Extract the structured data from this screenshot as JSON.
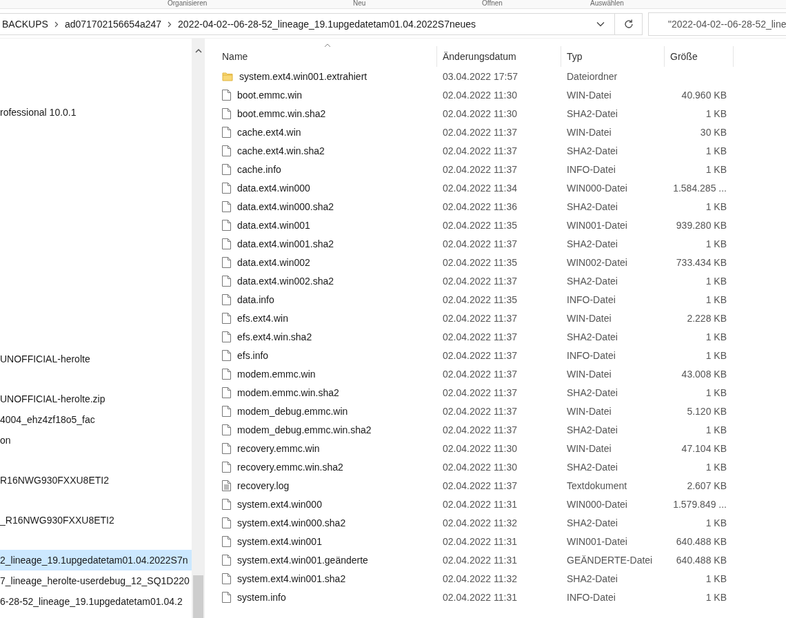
{
  "ribbon_groups": [
    "Organisieren",
    "Neu",
    "Öffnen",
    "Auswählen"
  ],
  "breadcrumb": [
    "BACKUPS",
    "ad071702156654a247",
    "2022-04-02--06-28-52_lineage_19.1upgedatetam01.04.2022S7neues"
  ],
  "search": {
    "value": "\"2022-04-02--06-28-52_line"
  },
  "nav_items": [
    {
      "label": "rofessional 10.0.1",
      "selected": false
    },
    {
      "label": "UNOFFICIAL-herolte",
      "selected": false
    },
    {
      "label": "UNOFFICIAL-herolte.zip",
      "selected": false
    },
    {
      "label": "4004_ehz4zf18o5_fac",
      "selected": false
    },
    {
      "label": "on",
      "selected": false
    },
    {
      "label": "R16NWG930FXXU8ETI2",
      "selected": false
    },
    {
      "label": "_R16NWG930FXXU8ETI2",
      "selected": false
    },
    {
      "label": "2_lineage_19.1upgedatetam01.04.2022S7n",
      "selected": true
    },
    {
      "label": "7_lineage_herolte-userdebug_12_SQ1D220",
      "selected": false
    },
    {
      "label": "6-28-52_lineage_19.1upgedatetam01.04.2",
      "selected": false
    }
  ],
  "table": {
    "columns": [
      "Name",
      "Änderungsdatum",
      "Typ",
      "Größe"
    ],
    "rows": [
      {
        "kind": "folder",
        "name": "system.ext4.win001.extrahiert",
        "date": "03.04.2022 17:57",
        "type": "Dateiordner",
        "size": ""
      },
      {
        "kind": "file",
        "name": "boot.emmc.win",
        "date": "02.04.2022 11:30",
        "type": "WIN-Datei",
        "size": "40.960 KB"
      },
      {
        "kind": "file",
        "name": "boot.emmc.win.sha2",
        "date": "02.04.2022 11:30",
        "type": "SHA2-Datei",
        "size": "1 KB"
      },
      {
        "kind": "file",
        "name": "cache.ext4.win",
        "date": "02.04.2022 11:37",
        "type": "WIN-Datei",
        "size": "30 KB"
      },
      {
        "kind": "file",
        "name": "cache.ext4.win.sha2",
        "date": "02.04.2022 11:37",
        "type": "SHA2-Datei",
        "size": "1 KB"
      },
      {
        "kind": "file",
        "name": "cache.info",
        "date": "02.04.2022 11:37",
        "type": "INFO-Datei",
        "size": "1 KB"
      },
      {
        "kind": "file",
        "name": "data.ext4.win000",
        "date": "02.04.2022 11:34",
        "type": "WIN000-Datei",
        "size": "1.584.285 ..."
      },
      {
        "kind": "file",
        "name": "data.ext4.win000.sha2",
        "date": "02.04.2022 11:36",
        "type": "SHA2-Datei",
        "size": "1 KB"
      },
      {
        "kind": "file",
        "name": "data.ext4.win001",
        "date": "02.04.2022 11:35",
        "type": "WIN001-Datei",
        "size": "939.280 KB"
      },
      {
        "kind": "file",
        "name": "data.ext4.win001.sha2",
        "date": "02.04.2022 11:37",
        "type": "SHA2-Datei",
        "size": "1 KB"
      },
      {
        "kind": "file",
        "name": "data.ext4.win002",
        "date": "02.04.2022 11:35",
        "type": "WIN002-Datei",
        "size": "733.434 KB"
      },
      {
        "kind": "file",
        "name": "data.ext4.win002.sha2",
        "date": "02.04.2022 11:37",
        "type": "SHA2-Datei",
        "size": "1 KB"
      },
      {
        "kind": "file",
        "name": "data.info",
        "date": "02.04.2022 11:35",
        "type": "INFO-Datei",
        "size": "1 KB"
      },
      {
        "kind": "file",
        "name": "efs.ext4.win",
        "date": "02.04.2022 11:37",
        "type": "WIN-Datei",
        "size": "2.228 KB"
      },
      {
        "kind": "file",
        "name": "efs.ext4.win.sha2",
        "date": "02.04.2022 11:37",
        "type": "SHA2-Datei",
        "size": "1 KB"
      },
      {
        "kind": "file",
        "name": "efs.info",
        "date": "02.04.2022 11:37",
        "type": "INFO-Datei",
        "size": "1 KB"
      },
      {
        "kind": "file",
        "name": "modem.emmc.win",
        "date": "02.04.2022 11:37",
        "type": "WIN-Datei",
        "size": "43.008 KB"
      },
      {
        "kind": "file",
        "name": "modem.emmc.win.sha2",
        "date": "02.04.2022 11:37",
        "type": "SHA2-Datei",
        "size": "1 KB"
      },
      {
        "kind": "file",
        "name": "modem_debug.emmc.win",
        "date": "02.04.2022 11:37",
        "type": "WIN-Datei",
        "size": "5.120 KB"
      },
      {
        "kind": "file",
        "name": "modem_debug.emmc.win.sha2",
        "date": "02.04.2022 11:37",
        "type": "SHA2-Datei",
        "size": "1 KB"
      },
      {
        "kind": "file",
        "name": "recovery.emmc.win",
        "date": "02.04.2022 11:30",
        "type": "WIN-Datei",
        "size": "47.104 KB"
      },
      {
        "kind": "file",
        "name": "recovery.emmc.win.sha2",
        "date": "02.04.2022 11:30",
        "type": "SHA2-Datei",
        "size": "1 KB"
      },
      {
        "kind": "text",
        "name": "recovery.log",
        "date": "02.04.2022 11:37",
        "type": "Textdokument",
        "size": "2.607 KB"
      },
      {
        "kind": "file",
        "name": "system.ext4.win000",
        "date": "02.04.2022 11:31",
        "type": "WIN000-Datei",
        "size": "1.579.849 ..."
      },
      {
        "kind": "file",
        "name": "system.ext4.win000.sha2",
        "date": "02.04.2022 11:32",
        "type": "SHA2-Datei",
        "size": "1 KB"
      },
      {
        "kind": "file",
        "name": "system.ext4.win001",
        "date": "02.04.2022 11:31",
        "type": "WIN001-Datei",
        "size": "640.488 KB"
      },
      {
        "kind": "file",
        "name": "system.ext4.win001.geänderte",
        "date": "02.04.2022 11:31",
        "type": "GEÄNDERTE-Datei",
        "size": "640.488 KB"
      },
      {
        "kind": "file",
        "name": "system.ext4.win001.sha2",
        "date": "02.04.2022 11:32",
        "type": "SHA2-Datei",
        "size": "1 KB"
      },
      {
        "kind": "file",
        "name": "system.info",
        "date": "02.04.2022 11:31",
        "type": "INFO-Datei",
        "size": "1 KB"
      }
    ]
  }
}
